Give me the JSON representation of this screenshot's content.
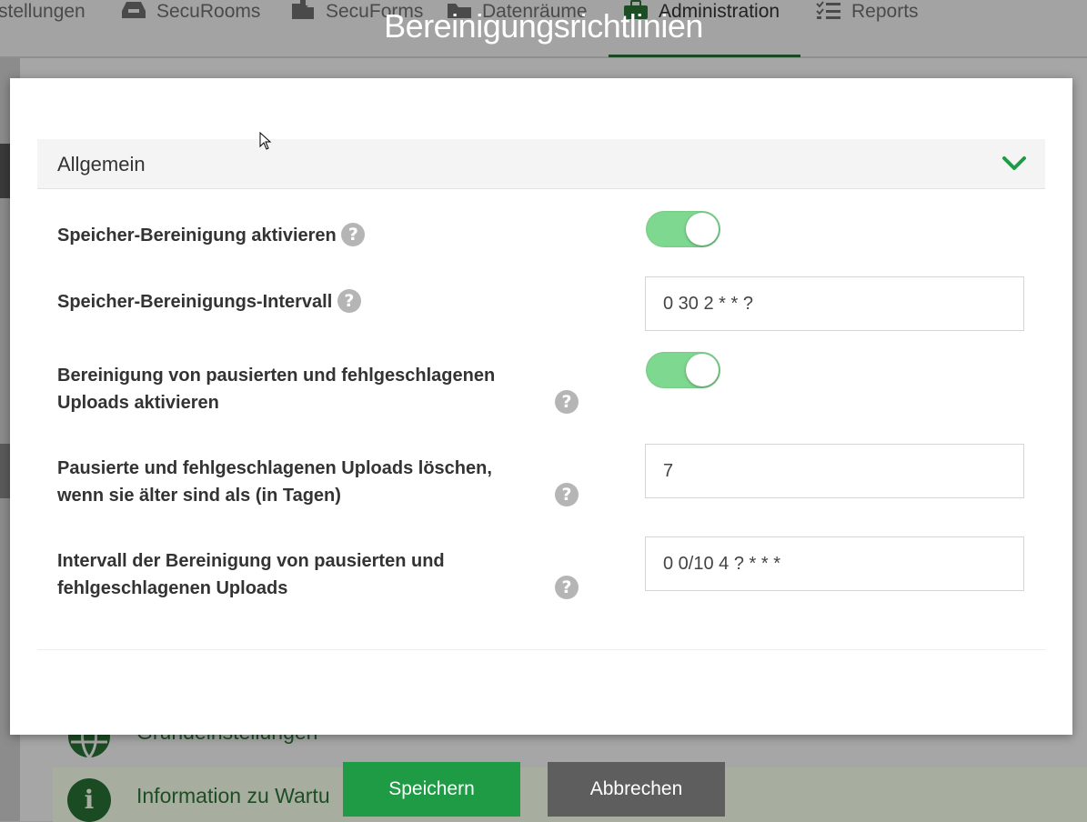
{
  "background": {
    "nav": [
      {
        "label": "stellungen",
        "icon": "gear-icon"
      },
      {
        "label": "SecuRooms",
        "icon": "inbox-icon"
      },
      {
        "label": "SecuForms",
        "icon": "form-icon"
      },
      {
        "label": "Datenräume",
        "icon": "folder-icon"
      },
      {
        "label": "Administration",
        "icon": "briefcase-icon"
      },
      {
        "label": "Reports",
        "icon": "list-icon"
      }
    ],
    "rows": [
      {
        "label": "Grundeinstellungen",
        "icon": "globe-icon"
      },
      {
        "label": "Information zu Wartu",
        "icon": "info-icon"
      }
    ]
  },
  "modal": {
    "title": "Bereinigungsrichtlinien",
    "section": {
      "title": "Allgemein",
      "icon": "chevron-down-icon"
    },
    "fields": {
      "enable_cleanup": {
        "label": "Speicher-Bereinigung aktivieren",
        "value": true
      },
      "cleanup_interval": {
        "label": "Speicher-Bereinigungs-Intervall",
        "value": "0 30 2 * * ?"
      },
      "enable_upload_cleanup": {
        "label_line1": "Bereinigung von pausierten und fehlgeschlagenen",
        "label_line2": "Uploads aktivieren",
        "value": true
      },
      "delete_older_than": {
        "label_line1": "Pausierte und fehlgeschlagenen Uploads löschen,",
        "label_line2": "wenn sie älter sind als (in Tagen)",
        "value": "7"
      },
      "upload_cleanup_interval": {
        "label_line1": "Intervall der Bereinigung von pausierten und",
        "label_line2": "fehlgeschlagenen Uploads",
        "value": "0 0/10 4 ? * * *"
      }
    },
    "help_glyph": "?"
  },
  "buttons": {
    "save": "Speichern",
    "cancel": "Abbrechen"
  },
  "colors": {
    "primary_green": "#1f9a45",
    "toggle_on": "#7fd890",
    "cancel_gray": "#5e5e5e",
    "chevron_green": "#1f9a45"
  }
}
